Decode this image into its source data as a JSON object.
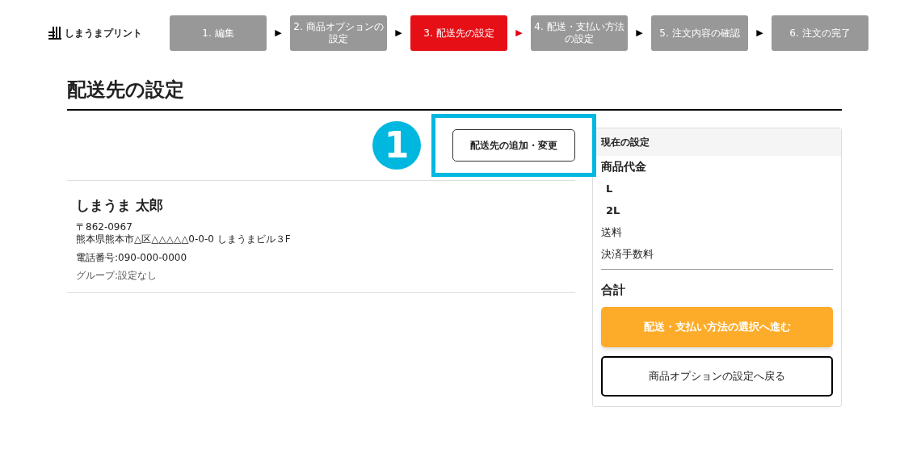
{
  "logo": {
    "text": "しまうまプリント"
  },
  "steps": [
    {
      "label": "1. 編集",
      "selected": false
    },
    {
      "label": "2. 商品オプションの設定",
      "selected": false
    },
    {
      "label": "3. 配送先の設定",
      "selected": true
    },
    {
      "label": "4. 配送・支払い方法の設定",
      "selected": false
    },
    {
      "label": "5. 注文内容の確認",
      "selected": false
    },
    {
      "label": "6. 注文の完了",
      "selected": false
    }
  ],
  "step_arrow": "▶",
  "page_title": "配送先の設定",
  "annotation": {
    "number": "1"
  },
  "add_button": "配送先の追加・変更",
  "address": {
    "name": "しまうま 太郎",
    "postal": "〒862-0967",
    "street": "熊本県熊本市△区△△△△△0-0-0 しまうまビル３F",
    "phone": "電話番号:090-000-0000",
    "group": "グループ:設定なし"
  },
  "summary": {
    "title": "現在の設定",
    "items": [
      {
        "kind": "heading",
        "label": "商品代金"
      },
      {
        "kind": "sub",
        "label": "L"
      },
      {
        "kind": "sub",
        "label": "2L"
      },
      {
        "kind": "plain",
        "label": "送料"
      },
      {
        "kind": "plain",
        "label": "決済手数料"
      }
    ],
    "total": "合計",
    "next_button": "配送・支払い方法の選択へ進む",
    "back_button": "商品オプションの設定へ戻る"
  }
}
